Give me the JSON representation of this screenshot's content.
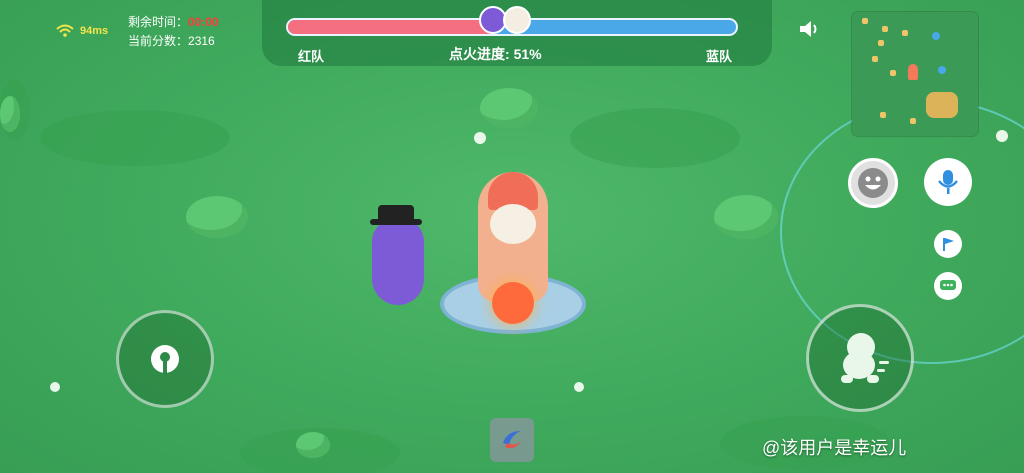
{
  "hud": {
    "ping": "94ms",
    "time_label": "剩余时间：",
    "time_value": "00:00",
    "score_label": "当前分数：",
    "score_value": "2316"
  },
  "progress": {
    "red_team_label": "红队",
    "blue_team_label": "蓝队",
    "ignition_label": "点火进度:",
    "ignition_percent_text": "51%",
    "ignition_fraction": 0.46,
    "red_color": "#f46f7f",
    "blue_color": "#4aa7e8"
  },
  "controls": {
    "joystick": "joystick-icon",
    "dash": "run-icon",
    "emote": "smile-icon",
    "mic": "mic-icon",
    "flag": "flag-icon",
    "chat": "chat-icon",
    "item": "boomerang-icon",
    "sound": "speaker-icon"
  },
  "watermark": "@该用户是幸运儿"
}
